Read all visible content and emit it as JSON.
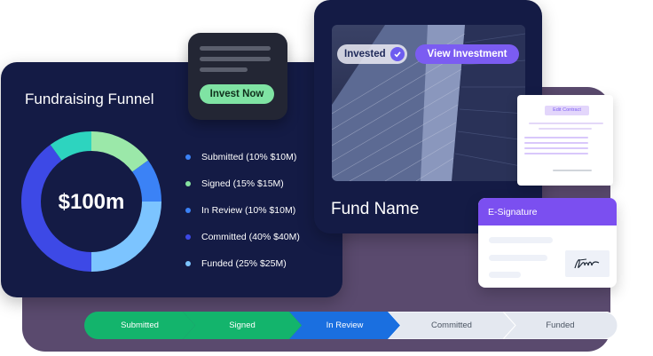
{
  "funnel": {
    "title": "Fundraising Funnel",
    "total": "$100m",
    "legend": [
      {
        "label": "Submitted (10% $10M)",
        "color": "#3b82f6"
      },
      {
        "label": "Signed (15% $15M)",
        "color": "#86e3a0"
      },
      {
        "label": "In Review (10% $10M)",
        "color": "#3b82f6"
      },
      {
        "label": "Committed (40% $40M)",
        "color": "#3d49e6"
      },
      {
        "label": "Funded (25% $25M)",
        "color": "#7cc4ff"
      }
    ],
    "segments": [
      {
        "name": "Signed",
        "value": 15,
        "color": "#9be8a9"
      },
      {
        "name": "Submitted",
        "value": 10,
        "color": "#3b82f6"
      },
      {
        "name": "Funded",
        "value": 25,
        "color": "#7cc4ff"
      },
      {
        "name": "Committed",
        "value": 40,
        "color": "#3d49e6"
      },
      {
        "name": "In Review",
        "value": 10,
        "color": "#2dd4bf"
      }
    ]
  },
  "invest_card": {
    "button_label": "Invest Now"
  },
  "fund_card": {
    "invested_label": "Invested",
    "view_button_label": "View Investment",
    "fund_name": "Fund Name"
  },
  "contract": {
    "button_label": "Edit Contract"
  },
  "esignature": {
    "title": "E-Signature"
  },
  "stages": [
    {
      "label": "Submitted",
      "color": "#13b46c",
      "text_color": "#ffffff"
    },
    {
      "label": "Signed",
      "color": "#13b46c",
      "text_color": "#ffffff"
    },
    {
      "label": "In Review",
      "color": "#1a6fe0",
      "text_color": "#ffffff"
    },
    {
      "label": "Committed",
      "color": "#e4e8f0",
      "text_color": "#4b5563"
    },
    {
      "label": "Funded",
      "color": "#e4e8f0",
      "text_color": "#4b5563"
    }
  ]
}
